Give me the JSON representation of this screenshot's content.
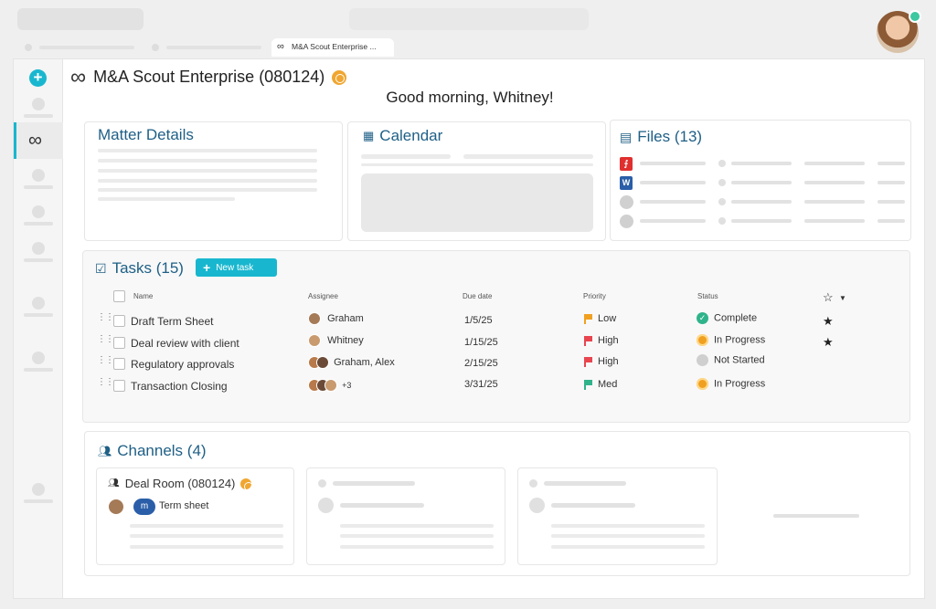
{
  "browser": {
    "active_tab": {
      "label": "M&A Scout Enterprise ...",
      "icon": "infinity-icon"
    }
  },
  "sidebar": {
    "add_icon": "+",
    "active_icon": "∞"
  },
  "header": {
    "matter_title": "M&A Scout Enterprise (080124)",
    "greeting": "Good morning, Whitney!"
  },
  "matter_details": {
    "title": "Matter Details"
  },
  "calendar": {
    "title": "Calendar"
  },
  "files": {
    "title": "Files (13)",
    "types": [
      "pdf",
      "word",
      "unknown",
      "unknown"
    ]
  },
  "tasks": {
    "title": "Tasks (15)",
    "new_task_label": "New task",
    "columns": {
      "name": "Name",
      "assignee": "Assignee",
      "due": "Due date",
      "priority": "Priority",
      "status": "Status"
    },
    "rows": [
      {
        "name": "Draft Term Sheet",
        "assignee": "Graham",
        "due": "1/5/25",
        "priority": "Low",
        "priority_color": "#f0a020",
        "status": "Complete",
        "status_icon": "check-icon",
        "starred": true
      },
      {
        "name": "Deal review with client",
        "assignee": "Whitney",
        "due": "1/15/25",
        "priority": "High",
        "priority_color": "#e8454f",
        "status": "In Progress",
        "status_icon": "progress-icon",
        "starred": true
      },
      {
        "name": "Regulatory approvals",
        "assignee": "Graham, Alex",
        "due": "2/15/25",
        "priority": "High",
        "priority_color": "#e8454f",
        "status": "Not Started",
        "status_icon": "not-started-icon",
        "starred": false
      },
      {
        "name": "Transaction Closing",
        "assignee": "+3",
        "due": "3/31/25",
        "priority": "Med",
        "priority_color": "#2fb38a",
        "status": "In Progress",
        "status_icon": "progress-icon",
        "starred": false
      }
    ]
  },
  "channels": {
    "title": "Channels (4)",
    "items": [
      {
        "name": "Deal Room (080124)",
        "message_badge": "m",
        "message": "Term sheet"
      }
    ]
  },
  "colors": {
    "accent": "#18b7cf",
    "heading": "#1e5f86",
    "complete": "#2fb38a",
    "progress": "#f0a020"
  }
}
